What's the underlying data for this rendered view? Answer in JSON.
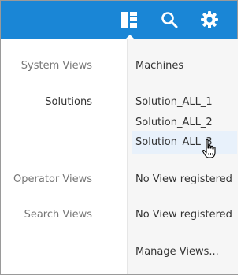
{
  "toolbar": {
    "views_icon": "views-grid-icon",
    "search_icon": "search-icon",
    "settings_icon": "gear-icon",
    "color": "#1a86d6"
  },
  "menu": {
    "categories": [
      {
        "label": "System Views"
      },
      {
        "label": "Solutions"
      },
      {
        "label": "Operator Views"
      },
      {
        "label": "Search Views"
      }
    ],
    "items": {
      "system": [
        "Machines"
      ],
      "solutions": [
        "Solution_ALL_1",
        "Solution_ALL_2",
        "Solution_ALL_3"
      ],
      "operator": [
        "No View registered"
      ],
      "search": [
        "No View registered"
      ],
      "manage": "Manage Views..."
    },
    "hovered_item": "Solution_ALL_3"
  }
}
